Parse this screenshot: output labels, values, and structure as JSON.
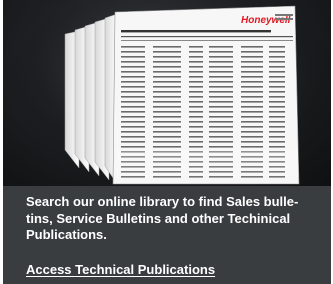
{
  "hero": {
    "brand": "Honeywell",
    "document_heading": "CROSS-REFERENCE OF PARTNO. TO PUBLICATION NO. AND ATA NO."
  },
  "description": "Search our online library to find Sales bulle-tins, Service Bulletins and other Techinical Publications.",
  "link_label": "Access Technical Publications"
}
